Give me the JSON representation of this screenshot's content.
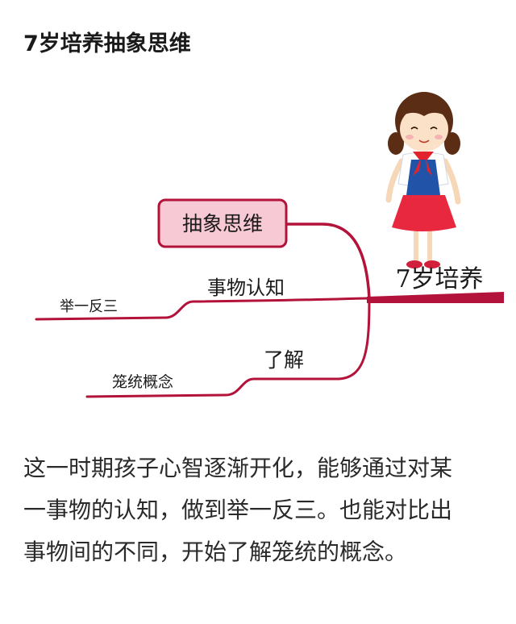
{
  "heading": "7岁培养抽象思维",
  "mindmap": {
    "root": "7岁培养",
    "boxed_node": "抽象思维",
    "branch_1": "事物认知",
    "leaf_1": "举一反三",
    "branch_2": "了解",
    "leaf_2": "笼统概念",
    "line_color": "#b3123a",
    "box_fill": "#f7c9d4"
  },
  "paragraph": {
    "line1": "这一时期孩子心智逐渐开化，能够通过对某",
    "line2": "一事物的认知，做到举一反三。也能对比出",
    "line3": "事物间的不同，开始了解笼统的概念。"
  }
}
